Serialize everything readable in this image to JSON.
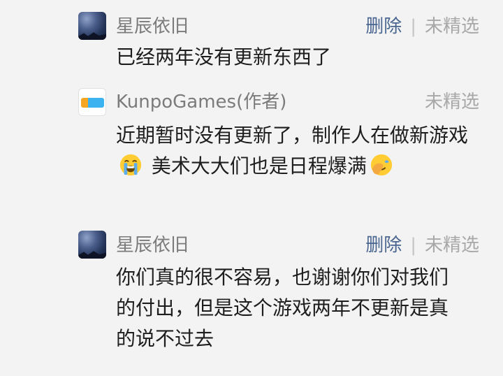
{
  "comments": [
    {
      "author": "星辰依旧",
      "actions": {
        "delete": "删除",
        "separator": "|",
        "select": "未精选"
      },
      "text": "已经两年没有更新东西了"
    },
    {
      "author": "KunpoGames(作者)",
      "actions": {
        "select": "未精选"
      },
      "text_part1": "近期暂时没有更新了，制作人在做新游戏",
      "text_part2": " 美术大大们也是日程爆满",
      "emoji1": "loudly-crying-face-icon",
      "emoji2": "face-palm-icon"
    },
    {
      "author": "星辰依旧",
      "actions": {
        "delete": "删除",
        "separator": "|",
        "select": "未精选"
      },
      "text": "你们真的很不容易，也谢谢你们对我们的付出，但是这个游戏两年不更新是真的说不过去"
    }
  ],
  "colors": {
    "background": "#f3f3f3",
    "name": "#7b7b7b",
    "delete": "#4a6690",
    "unselected": "#a8a8a8",
    "body": "#1e1e1e"
  }
}
